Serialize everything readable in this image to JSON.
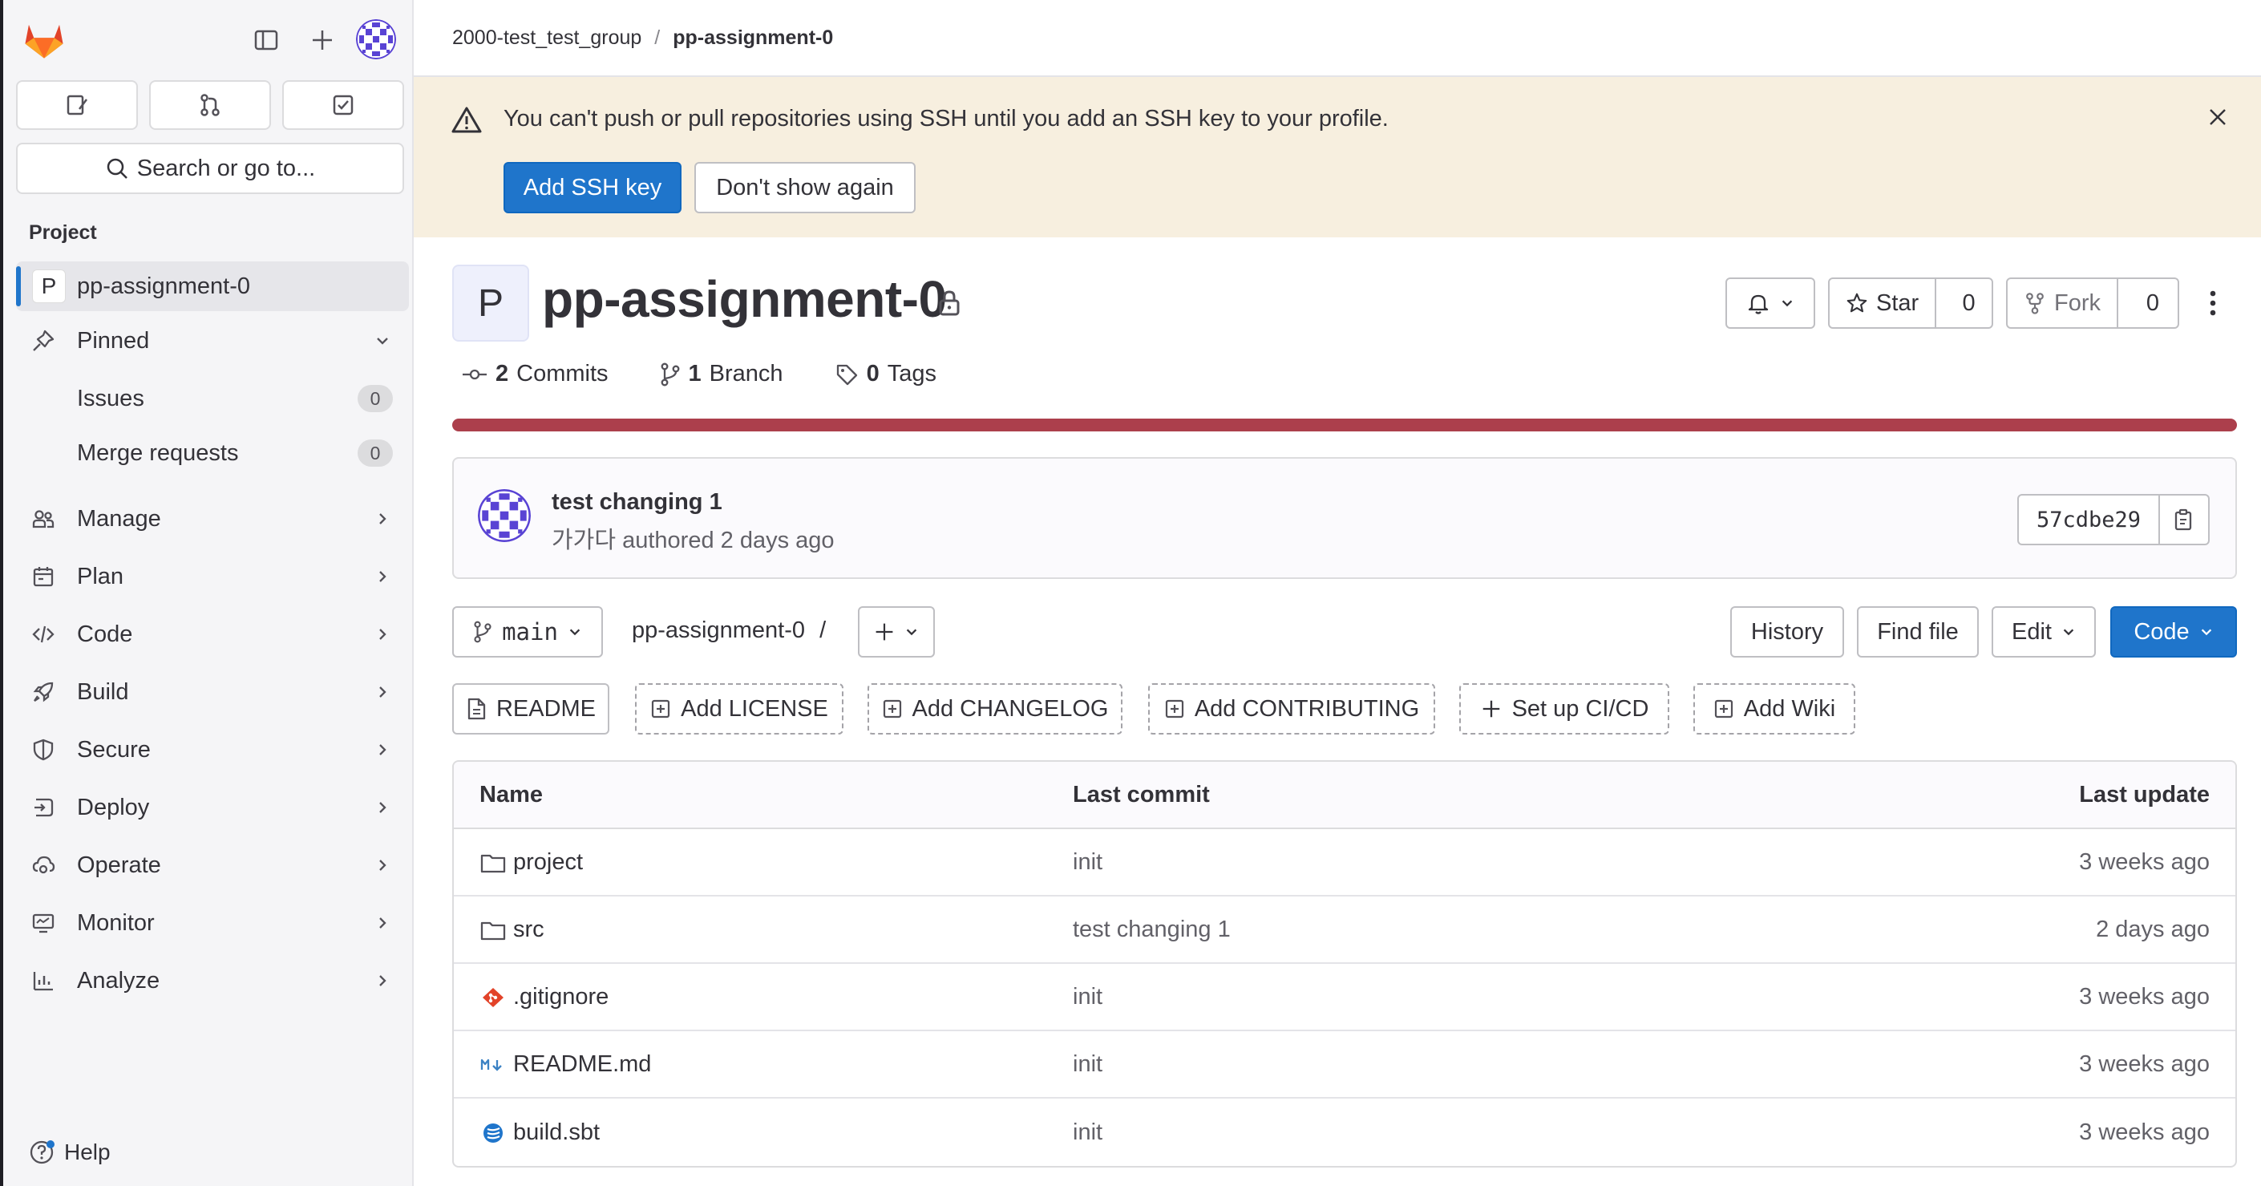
{
  "sidebar": {
    "search_placeholder": "Search or go to...",
    "section_label": "Project",
    "project": {
      "letter": "P",
      "name": "pp-assignment-0"
    },
    "pinned": {
      "label": "Pinned",
      "items": [
        {
          "label": "Issues",
          "count": "0"
        },
        {
          "label": "Merge requests",
          "count": "0"
        }
      ]
    },
    "nav": [
      {
        "label": "Manage",
        "icon": "users-icon"
      },
      {
        "label": "Plan",
        "icon": "calendar-icon"
      },
      {
        "label": "Code",
        "icon": "code-icon"
      },
      {
        "label": "Build",
        "icon": "rocket-icon"
      },
      {
        "label": "Secure",
        "icon": "shield-icon"
      },
      {
        "label": "Deploy",
        "icon": "deploy-icon"
      },
      {
        "label": "Operate",
        "icon": "cloud-gear-icon"
      },
      {
        "label": "Monitor",
        "icon": "monitor-icon"
      },
      {
        "label": "Analyze",
        "icon": "chart-icon"
      }
    ],
    "help_label": "Help"
  },
  "breadcrumb": {
    "group": "2000-test_test_group",
    "separator": "/",
    "project": "pp-assignment-0"
  },
  "alert": {
    "message": "You can't push or pull repositories using SSH until you add an SSH key to your profile.",
    "primary_button": "Add SSH key",
    "secondary_button": "Don't show again"
  },
  "project": {
    "avatar_letter": "P",
    "title": "pp-assignment-0",
    "star_label": "Star",
    "star_count": "0",
    "fork_label": "Fork",
    "fork_count": "0",
    "stats": {
      "commits_count": "2",
      "commits_label": "Commits",
      "branches_count": "1",
      "branches_label": "Branch",
      "tags_count": "0",
      "tags_label": "Tags"
    }
  },
  "last_commit": {
    "title": "test changing 1",
    "author": "가가다",
    "meta_suffix": "authored 2 days ago",
    "sha": "57cdbe29"
  },
  "repo_toolbar": {
    "branch": "main",
    "path": "pp-assignment-0",
    "path_separator": "/",
    "history": "History",
    "find_file": "Find file",
    "edit": "Edit",
    "code": "Code"
  },
  "quick_actions": [
    {
      "label": "README",
      "style": "solid",
      "icon": "file-icon"
    },
    {
      "label": "Add LICENSE",
      "style": "dashed",
      "icon": "plus-square-icon"
    },
    {
      "label": "Add CHANGELOG",
      "style": "dashed",
      "icon": "plus-square-icon"
    },
    {
      "label": "Add CONTRIBUTING",
      "style": "dashed",
      "icon": "plus-square-icon"
    },
    {
      "label": "Set up CI/CD",
      "style": "dashed",
      "icon": "plus-icon"
    },
    {
      "label": "Add Wiki",
      "style": "dashed",
      "icon": "plus-square-icon"
    }
  ],
  "file_table": {
    "headers": {
      "name": "Name",
      "last_commit": "Last commit",
      "last_update": "Last update"
    },
    "rows": [
      {
        "name": "project",
        "icon": "folder-icon",
        "commit": "init",
        "updated": "3 weeks ago"
      },
      {
        "name": "src",
        "icon": "folder-icon",
        "commit": "test changing 1",
        "updated": "2 days ago"
      },
      {
        "name": ".gitignore",
        "icon": "git-icon",
        "commit": "init",
        "updated": "3 weeks ago"
      },
      {
        "name": "README.md",
        "icon": "markdown-icon",
        "commit": "init",
        "updated": "3 weeks ago"
      },
      {
        "name": "build.sbt",
        "icon": "scala-icon",
        "commit": "init",
        "updated": "3 weeks ago"
      }
    ]
  },
  "colors": {
    "accent": "#1f75cb",
    "alert_bg": "#f7efdf",
    "progress": "#ac3f4c",
    "logo_orange": "#e24329",
    "avatar_purple": "#5943d4"
  }
}
